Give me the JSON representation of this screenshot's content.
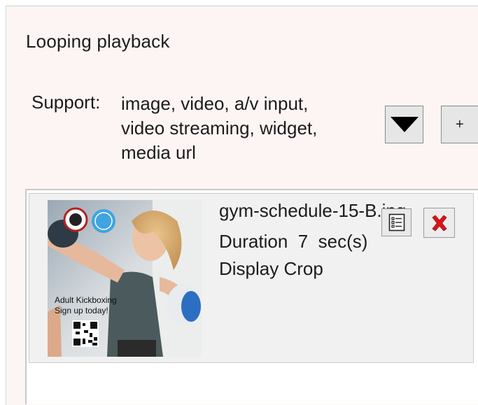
{
  "section": {
    "title": "Looping playback"
  },
  "support": {
    "label": "Support:",
    "lines": [
      "image, video, a/v input,",
      "video streaming, widget,",
      "media url"
    ]
  },
  "toolbar": {
    "dropdown_icon": "triangle-down-icon",
    "add_label": "+"
  },
  "playlist": {
    "items": [
      {
        "name": "gym-schedule-15-B.jpg",
        "duration_label": "Duration",
        "duration_value": "7",
        "duration_unit": "sec(s)",
        "display_label": "Display",
        "display_mode": "Crop",
        "thumbnail": {
          "caption_line1": "Adult Kickboxing",
          "caption_line2": "Sign up today!"
        },
        "properties_icon": "list-icon",
        "delete_icon": "close-x-icon",
        "delete_color": "#e0121b"
      }
    ]
  }
}
